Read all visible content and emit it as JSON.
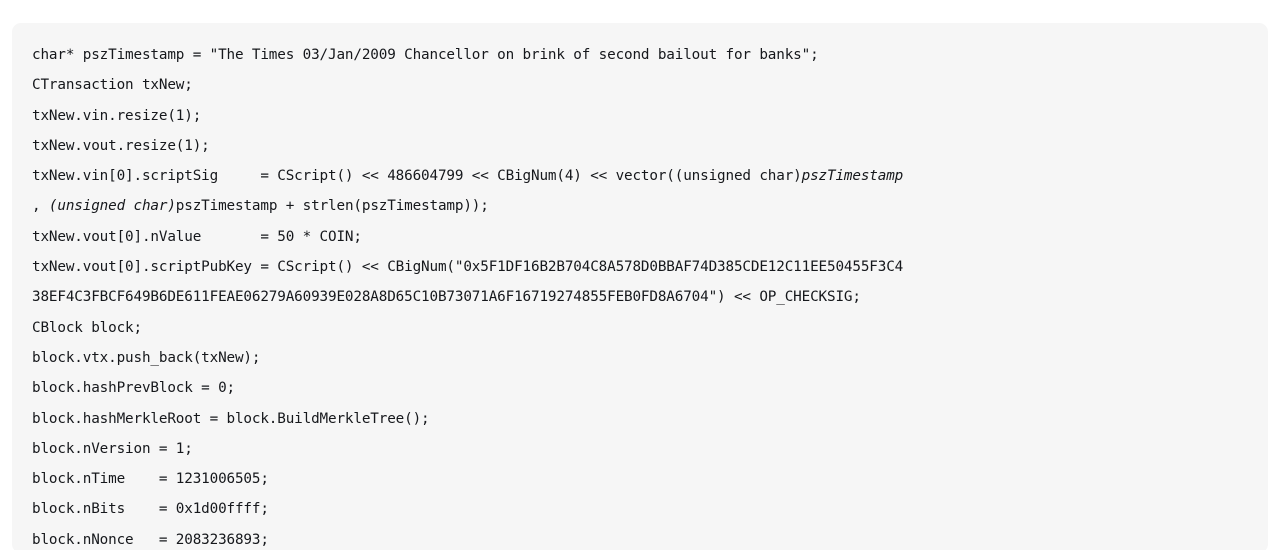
{
  "code_block": {
    "language": "cpp",
    "background_color": "#f6f6f6",
    "text_color": "#16181c",
    "page_background": "#ffffff",
    "lines": [
      {
        "id": "line-1",
        "segments": [
          {
            "text": "char* pszTimestamp = \"The Times 03/Jan/2009 Chancellor on brink of second bailout for banks\";",
            "italic": false
          }
        ]
      },
      {
        "id": "line-2",
        "segments": [
          {
            "text": "CTransaction txNew;",
            "italic": false
          }
        ]
      },
      {
        "id": "line-3",
        "segments": [
          {
            "text": "txNew.vin.resize(1);",
            "italic": false
          }
        ]
      },
      {
        "id": "line-4",
        "segments": [
          {
            "text": "txNew.vout.resize(1);",
            "italic": false
          }
        ]
      },
      {
        "id": "line-5",
        "segments": [
          {
            "text": "txNew.vin[0].scriptSig     = CScript() << 486604799 << CBigNum(4) << vector((unsigned char)",
            "italic": false
          },
          {
            "text": "pszTimestamp",
            "italic": true
          }
        ]
      },
      {
        "id": "line-6",
        "segments": [
          {
            "text": ", ",
            "italic": false
          },
          {
            "text": "(unsigned char)",
            "italic": true
          },
          {
            "text": "pszTimestamp + strlen(pszTimestamp));",
            "italic": false
          }
        ]
      },
      {
        "id": "line-7",
        "segments": [
          {
            "text": "txNew.vout[0].nValue       = 50 * COIN;",
            "italic": false
          }
        ]
      },
      {
        "id": "line-8",
        "segments": [
          {
            "text": "txNew.vout[0].scriptPubKey = CScript() << CBigNum(\"0x5F1DF16B2B704C8A578D0BBAF74D385CDE12C11EE50455F3C4",
            "italic": false
          }
        ]
      },
      {
        "id": "line-9",
        "segments": [
          {
            "text": "38EF4C3FBCF649B6DE611FEAE06279A60939E028A8D65C10B73071A6F16719274855FEB0FD8A6704\") << OP_CHECKSIG;",
            "italic": false
          }
        ]
      },
      {
        "id": "line-10",
        "segments": [
          {
            "text": "CBlock block;",
            "italic": false
          }
        ]
      },
      {
        "id": "line-11",
        "segments": [
          {
            "text": "block.vtx.push_back(txNew);",
            "italic": false
          }
        ]
      },
      {
        "id": "line-12",
        "segments": [
          {
            "text": "block.hashPrevBlock = 0;",
            "italic": false
          }
        ]
      },
      {
        "id": "line-13",
        "segments": [
          {
            "text": "block.hashMerkleRoot = block.BuildMerkleTree();",
            "italic": false
          }
        ]
      },
      {
        "id": "line-14",
        "segments": [
          {
            "text": "block.nVersion = 1;",
            "italic": false
          }
        ]
      },
      {
        "id": "line-15",
        "segments": [
          {
            "text": "block.nTime    = 1231006505;",
            "italic": false
          }
        ]
      },
      {
        "id": "line-16",
        "segments": [
          {
            "text": "block.nBits    = 0x1d00ffff;",
            "italic": false
          }
        ]
      },
      {
        "id": "line-17",
        "segments": [
          {
            "text": "block.nNonce   = 2083236893;",
            "italic": false
          }
        ]
      }
    ]
  }
}
